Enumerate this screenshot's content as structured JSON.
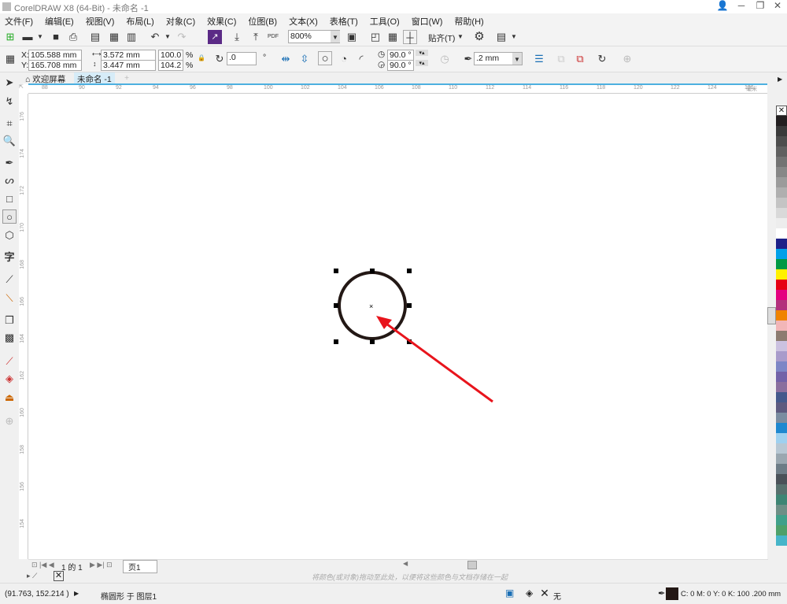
{
  "window": {
    "title": "CorelDRAW X8 (64-Bit) - 未命名 -1"
  },
  "menu": [
    "文件(F)",
    "编辑(E)",
    "视图(V)",
    "布局(L)",
    "对象(C)",
    "效果(C)",
    "位图(B)",
    "文本(X)",
    "表格(T)",
    "工具(O)",
    "窗口(W)",
    "帮助(H)"
  ],
  "standard_toolbar": {
    "zoom": "800%",
    "snap": "贴齐(T)",
    "pdf": "PDF"
  },
  "property_bar": {
    "x": "105.588 mm",
    "y": "165.708 mm",
    "x_label": "X:",
    "y_label": "Y:",
    "width": "3.572 mm",
    "height": "3.447 mm",
    "scale_x": "100.0",
    "scale_y": "104.2",
    "pct": "%",
    "rotation": ".0",
    "start_angle": "90.0 °",
    "end_angle": "90.0 °",
    "outline_width": ".2 mm"
  },
  "doc_tabs": [
    {
      "label": "欢迎屏幕"
    },
    {
      "label": "未命名 -1"
    }
  ],
  "rulers": {
    "h": [
      "88",
      "90",
      "92",
      "94",
      "96",
      "98",
      "100",
      "102",
      "104",
      "106",
      "108",
      "110",
      "112",
      "114",
      "116",
      "118",
      "120",
      "122",
      "124",
      "126"
    ],
    "v": [
      "176",
      "174",
      "172",
      "170",
      "168",
      "166",
      "164",
      "162",
      "160",
      "158",
      "156",
      "154"
    ],
    "unit": "毫米"
  },
  "page_nav": {
    "text": "1 的 1",
    "page_tab": "页1"
  },
  "color_hint": "将颜色(或对象)拖动至此处，以便将这些颜色与文档存储在一起",
  "status": {
    "coords": "(91.763, 152.214 )",
    "object": "椭圆形 于 图层1",
    "fill": "无",
    "outline": "C: 0 M: 0 Y: 0 K: 100  .200 mm"
  },
  "palette": [
    "#231f20",
    "#3a3a3a",
    "#4d4d4d",
    "#606060",
    "#737373",
    "#878787",
    "#9b9b9b",
    "#afafaf",
    "#c4c4c4",
    "#d9d9d9",
    "#ededed",
    "#ffffff",
    "#1d2088",
    "#00a0e9",
    "#009944",
    "#fff100",
    "#e60012",
    "#e4007f",
    "#b3307c",
    "#f08300",
    "#f2b6b8",
    "#8c7b70",
    "#cbc1e0",
    "#a89bcb",
    "#7d86c6",
    "#7262a8",
    "#8a6f9e",
    "#44598c",
    "#5d5a7f",
    "#7a8ca0",
    "#1e88d0",
    "#9ed0ef",
    "#b7c7d3",
    "#9aa7b0",
    "#6d7c86",
    "#4a5158",
    "#57706d",
    "#3e8574",
    "#6e8f86",
    "#40a08a",
    "#4ea06a",
    "#46b5c9"
  ],
  "colors": {
    "accent": "#4db0e0",
    "arrow": "#e8141c"
  }
}
